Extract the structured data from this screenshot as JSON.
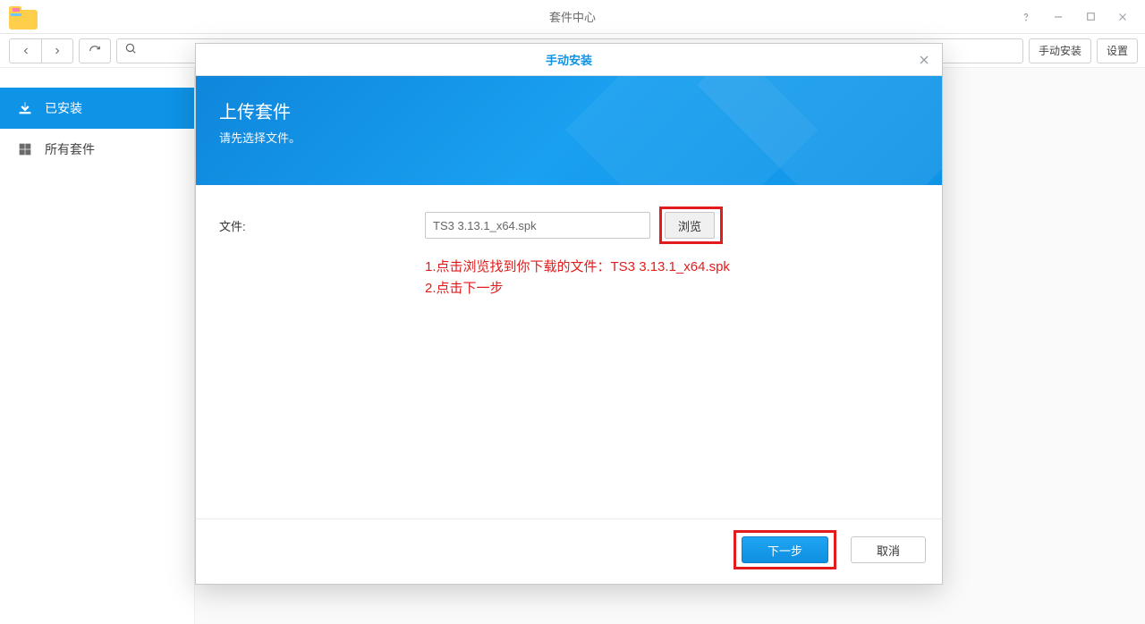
{
  "titlebar": {
    "title": "套件中心"
  },
  "toolbar": {
    "search_placeholder": "",
    "manual_install_label": "手动安装",
    "settings_label": "设置"
  },
  "sidebar": {
    "installed_label": "已安装",
    "all_label": "所有套件"
  },
  "modal": {
    "title": "手动安装",
    "banner_heading": "上传套件",
    "banner_sub": "请先选择文件。",
    "file_label": "文件:",
    "file_name": "TS3 3.13.1_x64.spk",
    "browse_label": "浏览",
    "instruction_line1": "1.点击浏览找到你下载的文件：TS3 3.13.1_x64.spk",
    "instruction_line2": "2.点击下一步",
    "next_label": "下一步",
    "cancel_label": "取消"
  }
}
